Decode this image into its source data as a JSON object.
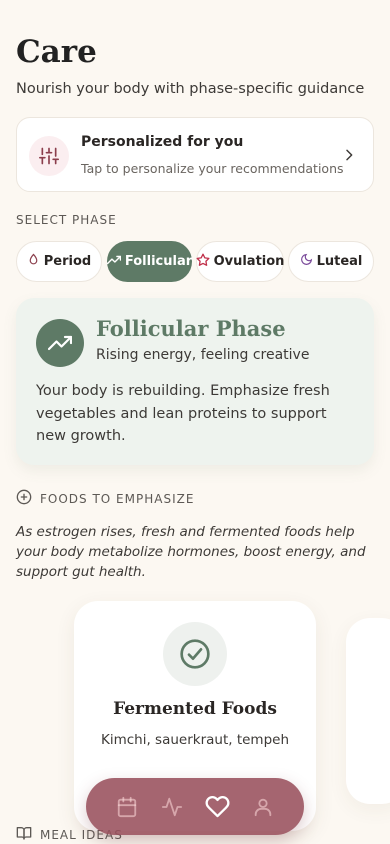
{
  "header": {
    "title": "Care",
    "subtitle": "Nourish your body with phase-specific guidance"
  },
  "personalized": {
    "title": "Personalized for you",
    "subtitle": "Tap to personalize your recommendations",
    "icon": "sliders-icon"
  },
  "phase_selector": {
    "label": "SELECT PHASE",
    "selected": "Follicular",
    "phases": [
      {
        "label": "Period",
        "icon": "droplet-icon"
      },
      {
        "label": "Follicular",
        "icon": "trending-up-icon"
      },
      {
        "label": "Ovulation",
        "icon": "star-icon"
      },
      {
        "label": "Luteal",
        "icon": "moon-icon"
      }
    ]
  },
  "phase_card": {
    "name": "Follicular Phase",
    "tagline": "Rising energy, feeling creative",
    "description": "Your body is rebuilding. Emphasize fresh vegetables and lean proteins to support new growth.",
    "accent": "#5e7a66"
  },
  "foods": {
    "header": "FOODS TO EMPHASIZE",
    "note": "As estrogen rises, fresh and fermented foods help your body metabolize hormones, boost energy, and support gut health.",
    "cards": [
      {
        "title": "Fermented Foods",
        "items": "Kimchi, sauerkraut, tempeh",
        "icon": "check-circle-icon"
      }
    ]
  },
  "meal_ideas": {
    "header": "MEAL IDEAS"
  },
  "bottom_nav": {
    "items": [
      "calendar-icon",
      "activity-icon",
      "heart-icon",
      "user-icon"
    ],
    "active": "heart-icon",
    "color": "#98505c"
  },
  "colors": {
    "background": "#fcf8f2",
    "accent_green": "#5e7a66",
    "accent_rose": "#98505c"
  }
}
